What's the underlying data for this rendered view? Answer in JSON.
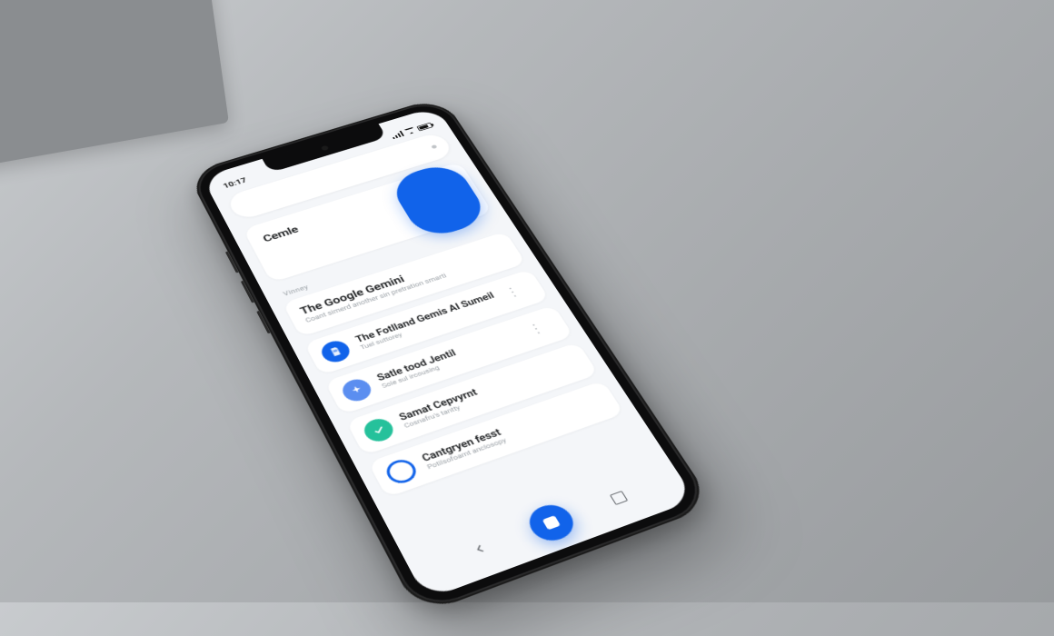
{
  "status": {
    "time": "10:17"
  },
  "header": {
    "title": "Cemle"
  },
  "section_label": "Vinney",
  "main_card": {
    "title": "The Google Gemini",
    "subtitle": "Coant simerd another sin pretration smarti"
  },
  "rows": [
    {
      "icon": "document-icon",
      "color": "bg-blue",
      "title": "The Fotlland Gemis AI Sumeil",
      "subtitle": "Tuel suttorey"
    },
    {
      "icon": "sparkle-icon",
      "color": "bg-lblue",
      "title": "Satle tood Jentil",
      "subtitle": "Sole sul ircousing"
    },
    {
      "icon": "check-icon",
      "color": "bg-teal",
      "title": "Samat Cepvyrnt",
      "subtitle": "Cosnafru's tantty"
    },
    {
      "icon": "circle-icon",
      "color": "bg-ring",
      "title": "Cantgryen fesst",
      "subtitle": "Potilsofoamt anclosopy"
    }
  ],
  "colors": {
    "accent": "#1163ea"
  }
}
